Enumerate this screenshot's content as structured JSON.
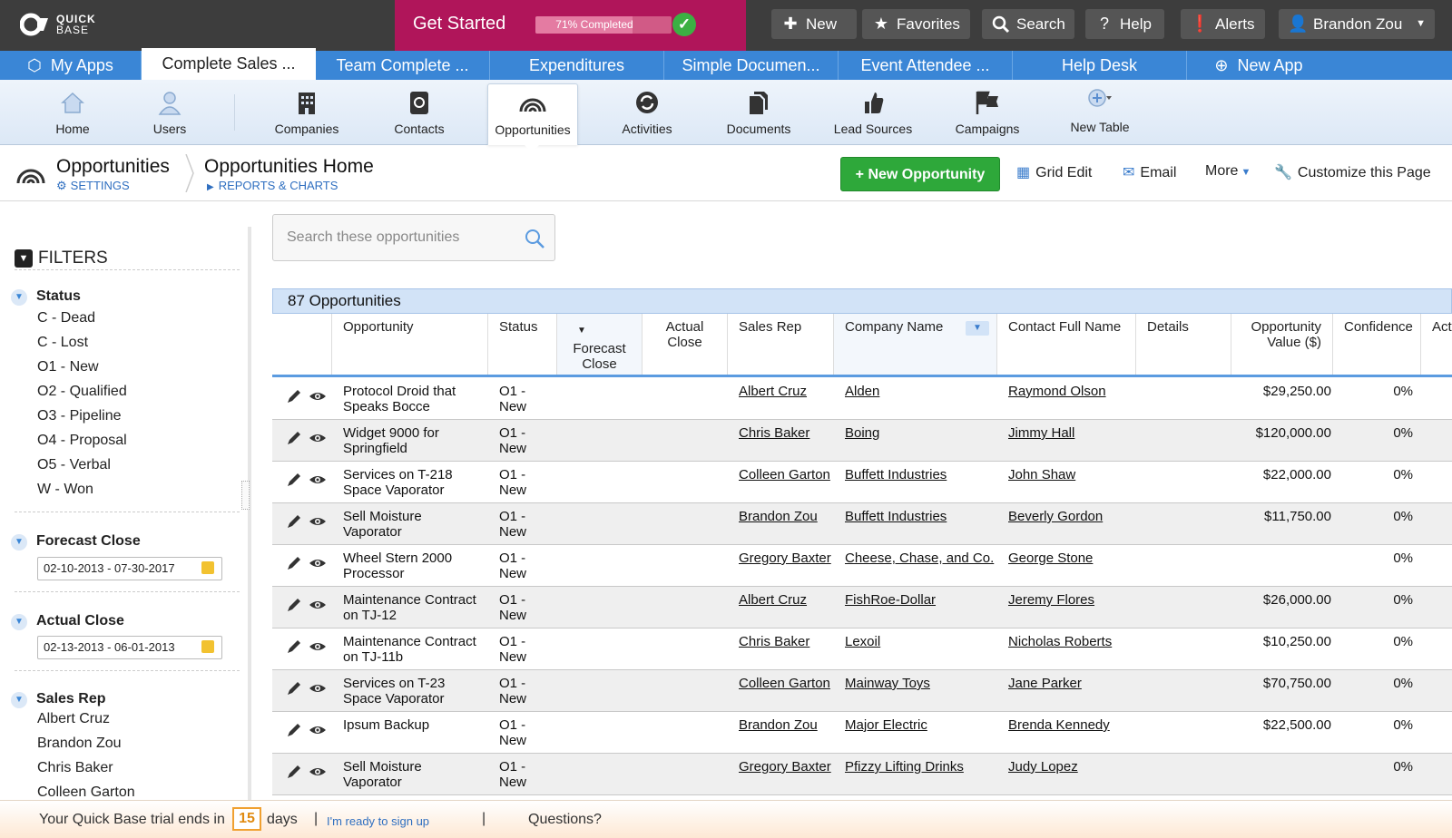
{
  "topbar": {
    "logo_line1": "QUICK",
    "logo_line2": "BASE",
    "get_started": "Get Started",
    "progress_text": "71% Completed",
    "progress_fraction": 0.71,
    "buttons": {
      "new": "New",
      "favorites": "Favorites",
      "search": "Search",
      "help": "Help",
      "alerts": "Alerts",
      "user": "Brandon Zou"
    }
  },
  "app_tabs": {
    "my_apps": "My Apps",
    "tabs": [
      "Complete Sales ...",
      "Team Complete ...",
      "Expenditures",
      "Simple Documen...",
      "Event Attendee ...",
      "Help Desk"
    ],
    "new_app": "New App"
  },
  "table_nav": {
    "items": [
      "Home",
      "Users",
      "Companies",
      "Contacts",
      "Opportunities",
      "Activities",
      "Documents",
      "Lead Sources",
      "Campaigns",
      "New Table"
    ]
  },
  "page_header": {
    "title": "Opportunities",
    "settings": "SETTINGS",
    "subtitle": "Opportunities Home",
    "reports": "REPORTS & CHARTS",
    "new_opportunity": "+ New Opportunity",
    "grid_edit": "Grid Edit",
    "email": "Email",
    "more": "More",
    "customize": "Customize this Page"
  },
  "filters": {
    "title": "FILTERS",
    "status_title": "Status",
    "status_items": [
      "C - Dead",
      "C - Lost",
      "O1 - New",
      "O2 - Qualified",
      "O3 - Pipeline",
      "O4 - Proposal",
      "O5 - Verbal",
      "W - Won"
    ],
    "forecast_title": "Forecast Close",
    "forecast_range": "02-10-2013 - 07-30-2017",
    "actual_title": "Actual Close",
    "actual_range": "02-13-2013 - 06-01-2013",
    "salesrep_title": "Sales Rep",
    "salesrep_items": [
      "Albert Cruz",
      "Brandon Zou",
      "Chris Baker",
      "Colleen Garton"
    ]
  },
  "search": {
    "placeholder": "Search these opportunities"
  },
  "grid": {
    "count_label": "87 Opportunities",
    "columns": {
      "opportunity": "Opportunity",
      "status": "Status",
      "forecast_close": "Forecast Close",
      "actual_close": "Actual Close",
      "sales_rep": "Sales Rep",
      "company": "Company Name",
      "contact": "Contact Full Name",
      "details": "Details",
      "value": "Opportunity Value ($)",
      "confidence": "Confidence",
      "act": "Act"
    },
    "rows": [
      {
        "opp1": "Protocol Droid that",
        "opp2": "Speaks Bocce",
        "st1": "O1 -",
        "st2": "New",
        "rep": "Albert Cruz",
        "company": "Alden",
        "contact": "Raymond Olson",
        "value": "$29,250.00",
        "conf": "0%"
      },
      {
        "opp1": "Widget 9000 for",
        "opp2": "Springfield",
        "st1": "O1 -",
        "st2": "New",
        "rep": "Chris Baker",
        "company": "Boing",
        "contact": "Jimmy Hall",
        "value": "$120,000.00",
        "conf": "0%"
      },
      {
        "opp1": "Services on T-218",
        "opp2": "Space Vaporator",
        "st1": "O1 -",
        "st2": "New",
        "rep": "Colleen Garton",
        "company": "Buffett Industries",
        "contact": "John Shaw",
        "value": "$22,000.00",
        "conf": "0%"
      },
      {
        "opp1": "Sell Moisture",
        "opp2": "Vaporator",
        "st1": "O1 -",
        "st2": "New",
        "rep": "Brandon Zou",
        "company": "Buffett Industries",
        "contact": "Beverly Gordon",
        "value": "$11,750.00",
        "conf": "0%"
      },
      {
        "opp1": "Wheel Stern 2000",
        "opp2": "Processor",
        "st1": "O1 -",
        "st2": "New",
        "rep": "Gregory Baxter",
        "company": "Cheese, Chase, and Co.",
        "contact": "George Stone",
        "value": "",
        "conf": "0%"
      },
      {
        "opp1": "Maintenance Contract",
        "opp2": "on TJ-12",
        "st1": "O1 -",
        "st2": "New",
        "rep": "Albert Cruz",
        "company": "FishRoe-Dollar",
        "contact": "Jeremy Flores",
        "value": "$26,000.00",
        "conf": "0%"
      },
      {
        "opp1": "Maintenance Contract",
        "opp2": "on TJ-11b",
        "st1": "O1 -",
        "st2": "New",
        "rep": "Chris Baker",
        "company": "Lexoil",
        "contact": "Nicholas Roberts",
        "value": "$10,250.00",
        "conf": "0%"
      },
      {
        "opp1": "Services on T-23",
        "opp2": "Space Vaporator",
        "st1": "O1 -",
        "st2": "New",
        "rep": "Colleen Garton",
        "company": "Mainway Toys",
        "contact": "Jane Parker",
        "value": "$70,750.00",
        "conf": "0%"
      },
      {
        "opp1": "Ipsum Backup",
        "opp2": "",
        "st1": "O1 -",
        "st2": "New",
        "rep": "Brandon Zou",
        "company": "Major Electric",
        "contact": "Brenda Kennedy",
        "value": "$22,500.00",
        "conf": "0%"
      },
      {
        "opp1": "Sell Moisture",
        "opp2": "Vaporator",
        "st1": "O1 -",
        "st2": "New",
        "rep": "Gregory Baxter",
        "company": "Pfizzy Lifting Drinks",
        "contact": "Judy Lopez",
        "value": "",
        "conf": "0%"
      }
    ]
  },
  "footer": {
    "trial_prefix": "Your Quick Base trial ends in",
    "days": "15",
    "days_suffix": "days",
    "signup": "I'm ready to sign up",
    "questions": "Questions?"
  },
  "colors": {
    "topbar": "#3d3d3d",
    "get_started": "#b0155a",
    "app_tabs": "#3a86d6",
    "new_button": "#2ea83a",
    "link": "#2f6fc0"
  }
}
